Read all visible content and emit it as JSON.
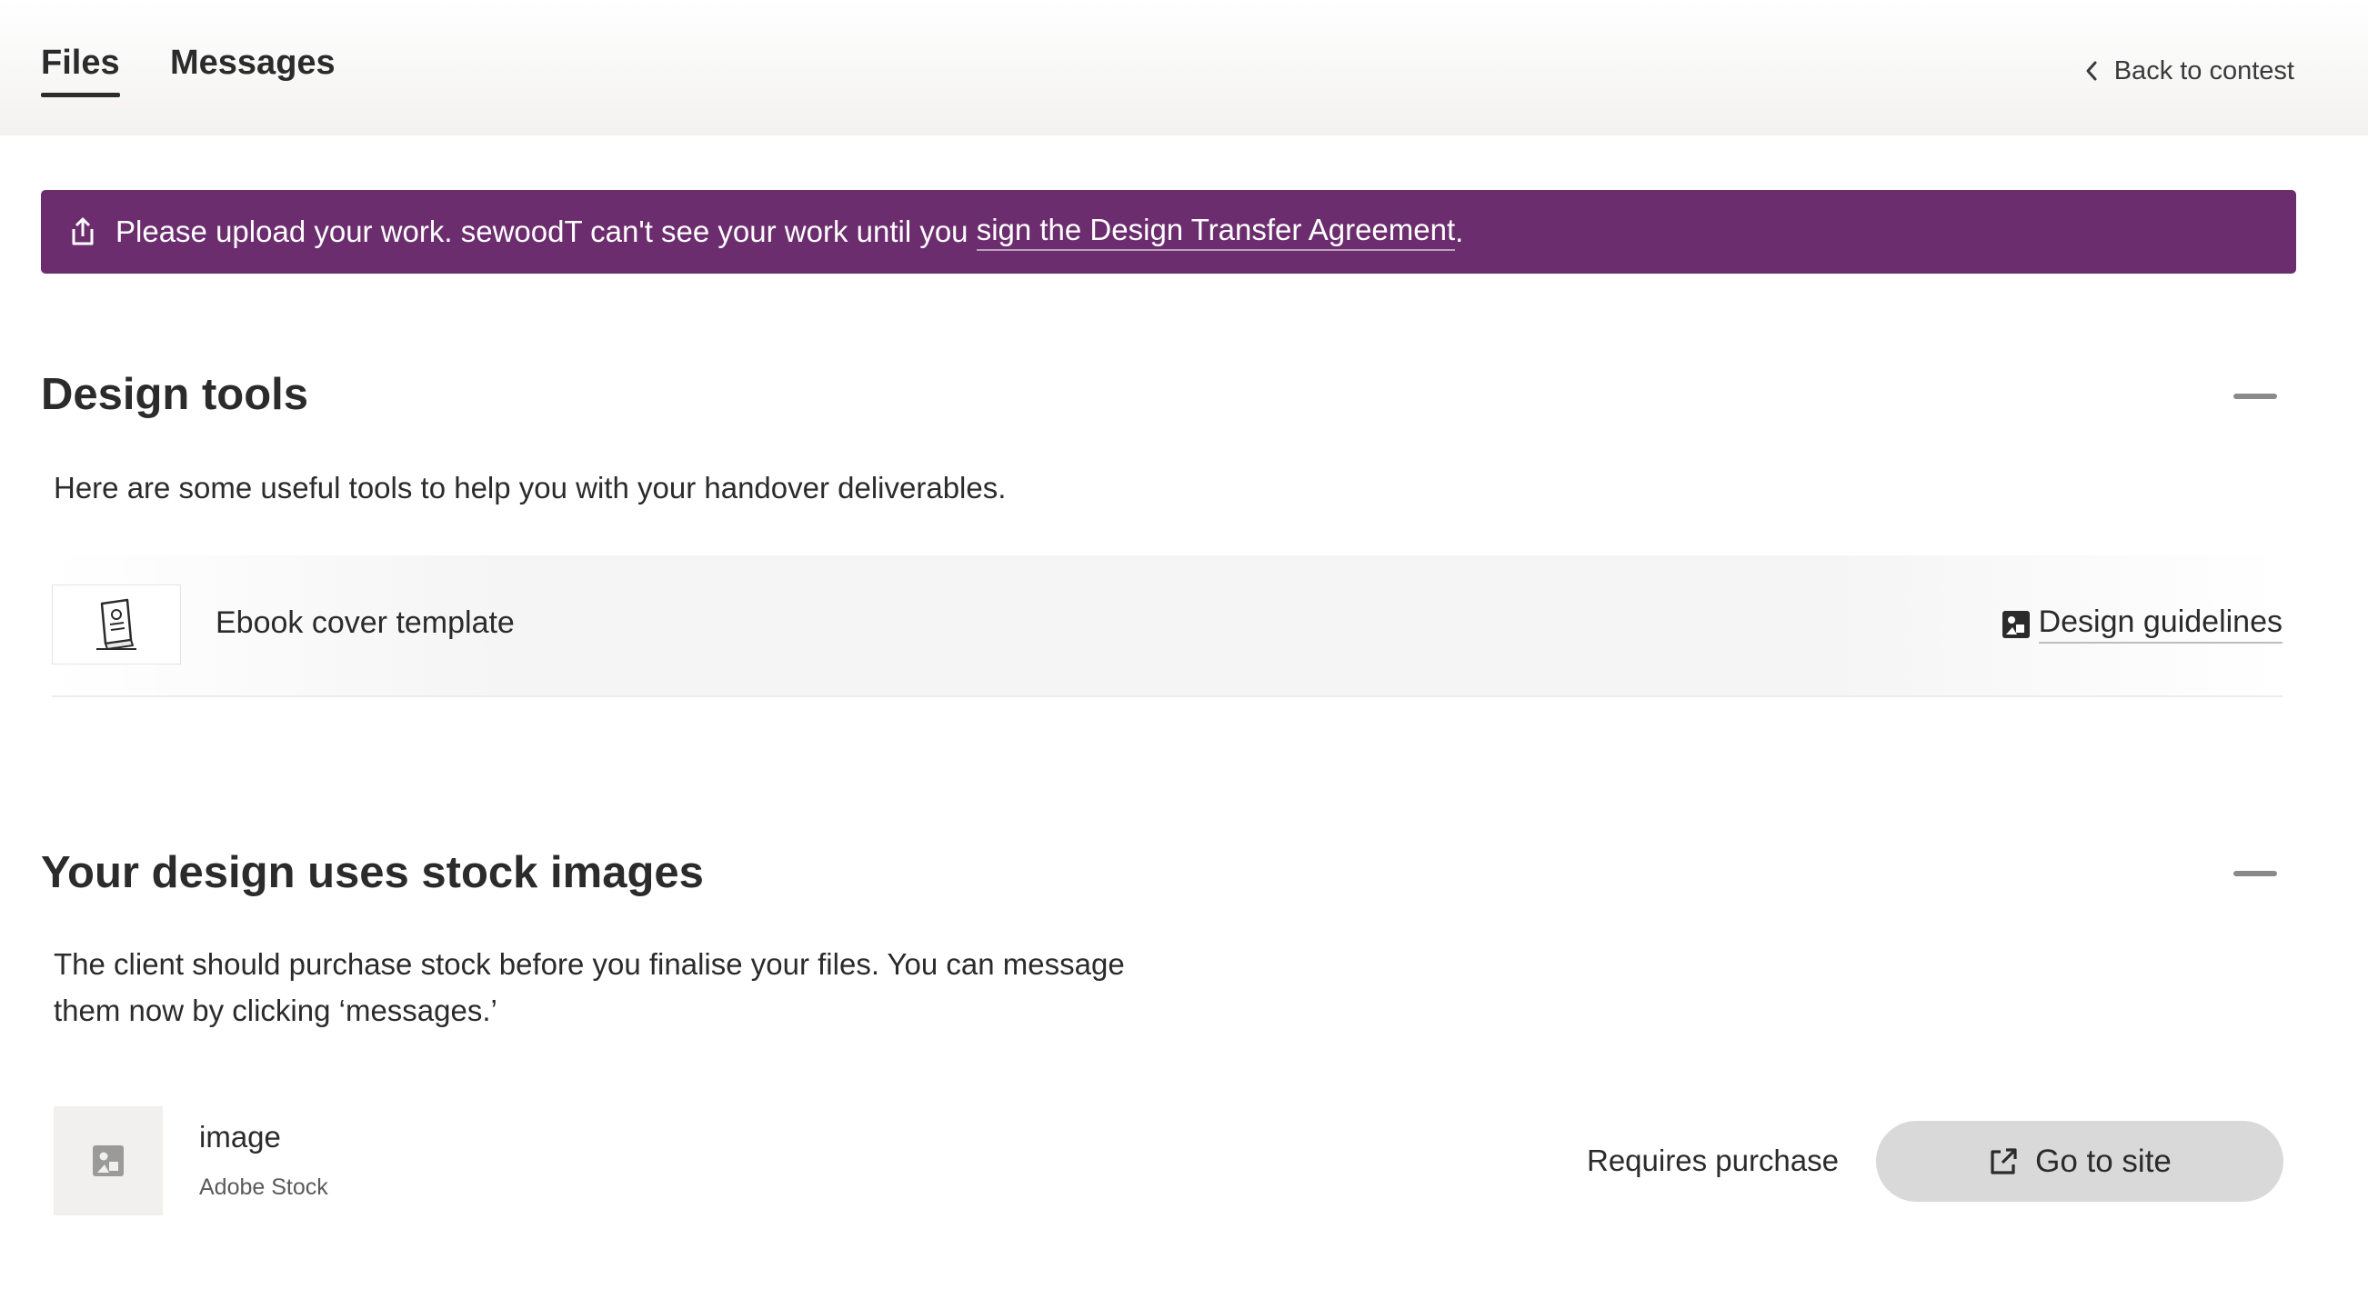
{
  "header": {
    "tabs": [
      {
        "label": "Files",
        "active": true
      },
      {
        "label": "Messages",
        "active": false
      }
    ],
    "back_link": "Back to contest",
    "back_icon": "chevron-left-icon"
  },
  "banner": {
    "icon": "upload-icon",
    "text_before": "Please upload your work. sewoodT can't see your work until you ",
    "link_text": "sign the Design Transfer Agreement",
    "text_after": ".",
    "background": "#6c2d6e"
  },
  "design_tools": {
    "title": "Design tools",
    "description": "Here are some useful tools to help you with your handover deliverables.",
    "items": [
      {
        "name": "Ebook cover template",
        "icon": "ebook-icon",
        "link_icon": "image-icon",
        "link_label": "Design guidelines"
      }
    ]
  },
  "stock_images": {
    "title": "Your design uses stock images",
    "description_line1": "The client should purchase stock before you finalise your files. You can message",
    "description_line2": "them now by clicking ‘messages.’",
    "items": [
      {
        "name": "image",
        "source": "Adobe Stock",
        "icon": "image-placeholder-icon",
        "status": "Requires purchase",
        "button_icon": "external-link-icon",
        "button_label": "Go to site"
      }
    ]
  }
}
